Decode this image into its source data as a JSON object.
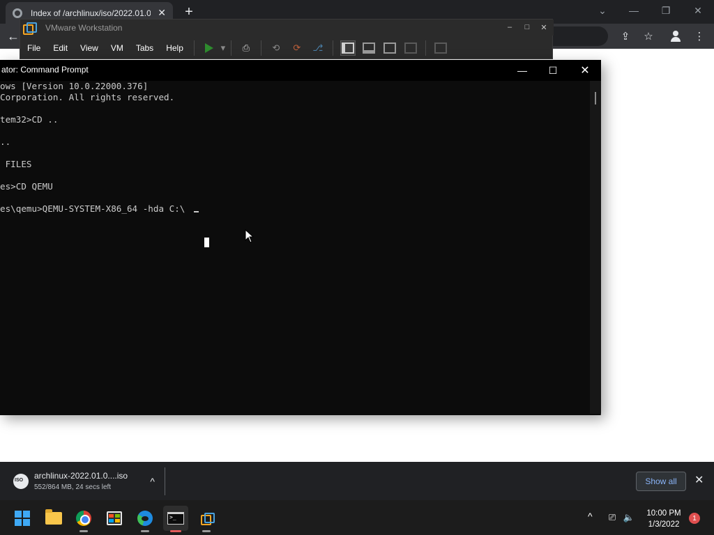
{
  "chrome": {
    "tab_title": "Index of /archlinux/iso/2022.01.0",
    "tab_close": "✕",
    "new_tab": "+",
    "minimize": "⌄",
    "min2": "—",
    "restore": "❐",
    "close": "✕"
  },
  "vmware": {
    "title": "VMware Workstation",
    "menu": [
      "File",
      "Edit",
      "View",
      "VM",
      "Tabs",
      "Help"
    ],
    "minimize": "–",
    "maximize": "□",
    "close": "✕"
  },
  "cmd": {
    "title": "ator: Command Prompt",
    "minimize": "—",
    "maximize": "☐",
    "close": "✕",
    "lines": [
      "ows [Version 10.0.22000.376]",
      "Corporation. All rights reserved.",
      "",
      "tem32>CD ..",
      "",
      "..",
      "",
      " FILES",
      "",
      "es>CD QEMU",
      "",
      "es\\qemu>QEMU-SYSTEM-X86_64 -hda C:\\"
    ]
  },
  "download": {
    "file_name": "archlinux-2022.01.0....iso",
    "status": "552/864 MB, 24 secs left",
    "show_all": "Show all",
    "close": "✕",
    "chevron": "^"
  },
  "taskbar": {
    "time": "10:00 PM",
    "date": "1/3/2022",
    "notifications": "1",
    "tray_chevron": "^"
  },
  "colors": {
    "chrome_dark": "#202124",
    "terminal_bg": "#0c0c0c",
    "link_blue": "#8ab4f8",
    "taskbar": "#1c1c1c"
  }
}
